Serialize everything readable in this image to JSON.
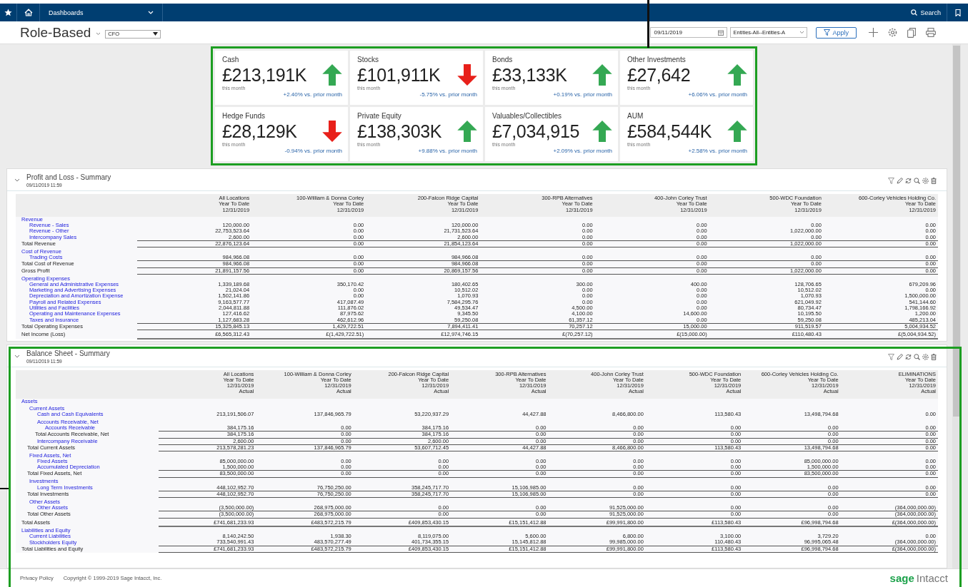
{
  "nav": {
    "menu": "Dashboards",
    "search": "Search"
  },
  "header": {
    "title": "Role-Based",
    "role": "CFO",
    "date": "09/11/2019",
    "entity": "Entities-All--Entities-A",
    "apply": "Apply"
  },
  "kpis": [
    {
      "label": "Cash",
      "value": "£213,191K",
      "rising": true,
      "period": "this month",
      "change": "+2.40% vs. prior month"
    },
    {
      "label": "Stocks",
      "value": "£101,911K",
      "rising": false,
      "period": "this month",
      "change": "-5.75% vs. prior month"
    },
    {
      "label": "Bonds",
      "value": "£33,133K",
      "rising": true,
      "period": "this month",
      "change": "+0.19% vs. prior month"
    },
    {
      "label": "Other Investments",
      "value": "£27,642",
      "rising": true,
      "period": "this month",
      "change": "+6.06% vs. prior month"
    },
    {
      "label": "Hedge Funds",
      "value": "£28,129K",
      "rising": false,
      "period": "this month",
      "change": "-0.94% vs. prior month"
    },
    {
      "label": "Private Equity",
      "value": "£138,303K",
      "rising": true,
      "period": "this month",
      "change": "+9.88% vs. prior month"
    },
    {
      "label": "Valuables/Collectibles",
      "value": "£7,034,915",
      "rising": true,
      "period": "this month",
      "change": "+2.09% vs. prior month"
    },
    {
      "label": "AUM",
      "value": "£584,544K",
      "rising": true,
      "period": "this month",
      "change": "+2.58% vs. prior month"
    }
  ],
  "reports": [
    {
      "kind": "pl",
      "title": "Profit and Loss - Summary",
      "timestamp": "09/11/2019 11:59",
      "columns": [
        [
          "All Locations",
          "Year To Date",
          "12/31/2019"
        ],
        [
          "100-William & Donna Corley",
          "Year To Date",
          "12/31/2019"
        ],
        [
          "200-Falcon Ridge Capital",
          "Year To Date",
          "12/31/2019"
        ],
        [
          "300-RPB Alternatives",
          "Year To Date",
          "12/31/2019"
        ],
        [
          "400-John Corley Trust",
          "Year To Date",
          "12/31/2019"
        ],
        [
          "500-WDC Foundation",
          "Year To Date",
          "12/31/2019"
        ],
        [
          "600-Corley Vehicles Holding Co.",
          "Year To Date",
          "12/31/2019"
        ]
      ],
      "rows": [
        {
          "kind": "group",
          "label": "Revenue",
          "children": [
            {
              "kind": "line",
              "label": "Revenue - Sales",
              "values": [
                "120,000.00",
                "0.00",
                "120,000.00",
                "0.00",
                "0.00",
                "0.00",
                "0.00"
              ]
            },
            {
              "kind": "line",
              "label": "Revenue - Other",
              "values": [
                "22,753,523.64",
                "0.00",
                "21,731,523.64",
                "0.00",
                "0.00",
                "1,022,000.00",
                "0.00"
              ]
            },
            {
              "kind": "line",
              "label": "Intercompany Sales",
              "values": [
                "2,600.00",
                "0.00",
                "2,600.00",
                "0.00",
                "0.00",
                "0.00",
                "0.00"
              ]
            }
          ]
        },
        {
          "kind": "total",
          "label": "Total Revenue",
          "values": [
            "22,876,123.64",
            "0.00",
            "21,854,123.64",
            "0.00",
            "0.00",
            "1,022,000.00",
            "0.00"
          ]
        },
        {
          "kind": "group",
          "label": "Cost of Revenue",
          "children": [
            {
              "kind": "line",
              "label": "Trading Costs",
              "values": [
                "984,966.08",
                "0.00",
                "984,966.08",
                "0.00",
                "0.00",
                "0.00",
                "0.00"
              ]
            }
          ]
        },
        {
          "kind": "total",
          "label": "Total Cost of Revenue",
          "values": [
            "984,966.08",
            "0.00",
            "984,966.08",
            "0.00",
            "0.00",
            "0.00",
            "0.00"
          ]
        },
        {
          "kind": "total",
          "label": "Gross Profit",
          "values": [
            "21,891,157.56",
            "0.00",
            "20,869,157.56",
            "0.00",
            "0.00",
            "1,022,000.00",
            "0.00"
          ]
        },
        {
          "kind": "group",
          "label": "Operating Expenses",
          "children": [
            {
              "kind": "line",
              "label": "General and Administrative Expenses",
              "values": [
                "1,339,189.68",
                "350,170.42",
                "180,402.65",
                "300.00",
                "400.00",
                "128,706.65",
                "679,209.96"
              ]
            },
            {
              "kind": "line",
              "label": "Marketing and Advertising Expenses",
              "values": [
                "21,024.04",
                "0.00",
                "10,512.02",
                "0.00",
                "0.00",
                "10,512.02",
                "0.00"
              ]
            },
            {
              "kind": "line",
              "label": "Depreciation and Amortization Expense",
              "values": [
                "1,502,141.86",
                "0.00",
                "1,070.93",
                "0.00",
                "0.00",
                "1,070.93",
                "1,500,000.00"
              ]
            },
            {
              "kind": "line",
              "label": "Payroll and Related Expenses",
              "values": [
                "9,163,577.77",
                "417,087.49",
                "7,584,295.76",
                "0.00",
                "0.00",
                "621,049.92",
                "541,144.60"
              ]
            },
            {
              "kind": "line",
              "label": "Utilities and Facilities",
              "values": [
                "2,044,811.88",
                "111,876.02",
                "49,534.47",
                "4,500.00",
                "0.00",
                "80,734.47",
                "1,798,166.92"
              ]
            },
            {
              "kind": "line",
              "label": "Operating and Maintenance Expenses",
              "values": [
                "127,416.62",
                "87,975.62",
                "9,345.50",
                "4,100.00",
                "14,600.00",
                "10,195.50",
                "1,200.00"
              ]
            },
            {
              "kind": "line",
              "label": "Taxes and Insurance",
              "values": [
                "1,127,683.28",
                "462,612.96",
                "59,250.08",
                "61,357.12",
                "0.00",
                "59,250.08",
                "485,213.04"
              ]
            }
          ]
        },
        {
          "kind": "total",
          "label": "Total Operating Expenses",
          "values": [
            "15,325,845.13",
            "1,429,722.51",
            "7,894,411.41",
            "70,257.12",
            "15,000.00",
            "911,519.57",
            "5,004,934.52"
          ]
        },
        {
          "kind": "grand",
          "label": "Net Income (Loss)",
          "values": [
            "£6,565,312.43",
            "£(1,429,722.51)",
            "£12,974,746.15",
            "£(70,257.12)",
            "£(15,000.00)",
            "£110,480.43",
            "£(5,004,934.52)"
          ]
        }
      ]
    },
    {
      "kind": "bs",
      "title": "Balance Sheet - Summary",
      "timestamp": "09/11/2019 11:59",
      "columns": [
        [
          "All Locations",
          "Year To Date",
          "12/31/2019",
          "Actual"
        ],
        [
          "100-William & Donna Corley",
          "Year To Date",
          "12/31/2019",
          "Actual"
        ],
        [
          "200-Falcon Ridge Capital",
          "Year To Date",
          "12/31/2019",
          "Actual"
        ],
        [
          "300-RPB Alternatives",
          "Year To Date",
          "12/31/2019",
          "Actual"
        ],
        [
          "400-John Corley Trust",
          "Year To Date",
          "12/31/2019",
          "Actual"
        ],
        [
          "500-WDC Foundation",
          "Year To Date",
          "12/31/2019",
          "Actual"
        ],
        [
          "600-Corley Vehicles Holding Co.",
          "Year To Date",
          "12/31/2019",
          "Actual"
        ],
        [
          "ELIMINATIONS",
          "Year To Date",
          "12/31/2019",
          "Actual"
        ]
      ],
      "rows": [
        {
          "kind": "group",
          "label": "Assets",
          "children": [
            {
              "kind": "group",
              "label": "Current Assets",
              "children": [
                {
                  "kind": "line",
                  "label": "Cash and Cash Equivalents",
                  "values": [
                    "213,191,506.07",
                    "137,846,965.79",
                    "53,220,937.29",
                    "44,427.88",
                    "8,466,800.00",
                    "113,580.43",
                    "13,498,794.68",
                    "0.00"
                  ]
                },
                {
                  "kind": "group",
                  "label": "Accounts Receivable, Net",
                  "children": [
                    {
                      "kind": "line",
                      "label": "Accounts Receivable",
                      "values": [
                        "384,175.16",
                        "0.00",
                        "384,175.16",
                        "0.00",
                        "0.00",
                        "0.00",
                        "0.00",
                        "0.00"
                      ]
                    }
                  ]
                },
                {
                  "kind": "total",
                  "label": "Total Accounts Receivable, Net",
                  "values": [
                    "384,175.16",
                    "0.00",
                    "384,175.16",
                    "0.00",
                    "0.00",
                    "0.00",
                    "0.00",
                    "0.00"
                  ]
                },
                {
                  "kind": "line",
                  "label": "Intercompany Receivable",
                  "values": [
                    "2,600.00",
                    "0.00",
                    "2,600.00",
                    "0.00",
                    "0.00",
                    "0.00",
                    "0.00",
                    "0.00"
                  ]
                }
              ]
            },
            {
              "kind": "total",
              "label": "Total Current Assets",
              "values": [
                "213,578,281.23",
                "137,846,965.79",
                "53,607,712.45",
                "44,427.88",
                "8,466,800.00",
                "113,580.43",
                "13,498,794.68",
                "0.00"
              ]
            },
            {
              "kind": "group",
              "label": "Fixed Assets, Net",
              "children": [
                {
                  "kind": "line",
                  "label": "Fixed Assets",
                  "values": [
                    "85,000,000.00",
                    "0.00",
                    "0.00",
                    "0.00",
                    "0.00",
                    "0.00",
                    "85,000,000.00",
                    "0.00"
                  ]
                },
                {
                  "kind": "line",
                  "label": "Accumulated Depreciation",
                  "values": [
                    "1,500,000.00",
                    "0.00",
                    "0.00",
                    "0.00",
                    "0.00",
                    "0.00",
                    "1,500,000.00",
                    "0.00"
                  ]
                }
              ]
            },
            {
              "kind": "total",
              "label": "Total Fixed Assets, Net",
              "values": [
                "83,500,000.00",
                "0.00",
                "0.00",
                "0.00",
                "0.00",
                "0.00",
                "83,500,000.00",
                "0.00"
              ]
            },
            {
              "kind": "group",
              "label": "Investments",
              "children": [
                {
                  "kind": "line",
                  "label": "Long Term Investments",
                  "values": [
                    "448,102,952.70",
                    "76,750,250.00",
                    "358,245,717.70",
                    "15,106,985.00",
                    "0.00",
                    "0.00",
                    "0.00",
                    "0.00"
                  ]
                }
              ]
            },
            {
              "kind": "total",
              "label": "Total Investments",
              "values": [
                "448,102,952.70",
                "76,750,250.00",
                "358,245,717.70",
                "15,106,985.00",
                "0.00",
                "0.00",
                "0.00",
                "0.00"
              ]
            },
            {
              "kind": "group",
              "label": "Other Assets",
              "children": [
                {
                  "kind": "line",
                  "label": "Other Assets",
                  "values": [
                    "(3,500,000.00)",
                    "268,975,000.00",
                    "0.00",
                    "0.00",
                    "91,525,000.00",
                    "0.00",
                    "0.00",
                    "(364,000,000.00)"
                  ]
                }
              ]
            },
            {
              "kind": "total",
              "label": "Total Other Assets",
              "values": [
                "(3,500,000.00)",
                "268,975,000.00",
                "0.00",
                "0.00",
                "91,525,000.00",
                "0.00",
                "0.00",
                "(364,000,000.00)"
              ]
            }
          ]
        },
        {
          "kind": "grand",
          "label": "Total Assets",
          "values": [
            "£741,681,233.93",
            "£483,572,215.79",
            "£409,853,430.15",
            "£15,151,412.88",
            "£99,991,800.00",
            "£113,580.43",
            "£96,998,794.68",
            "£(364,000,000.00)"
          ]
        },
        {
          "kind": "group",
          "label": "Liabilities and Equity",
          "children": [
            {
              "kind": "line",
              "label": "Current Liabilities",
              "values": [
                "8,140,242.50",
                "1,938.30",
                "8,119,075.00",
                "5,600.00",
                "6,800.00",
                "3,100.00",
                "3,729.20",
                "0.00"
              ]
            },
            {
              "kind": "line",
              "label": "Stockholders Equity",
              "values": [
                "733,540,991.43",
                "483,570,277.49",
                "401,734,355.15",
                "15,145,812.88",
                "99,985,000.00",
                "110,480.43",
                "96,995,065.48",
                "(364,000,000.00)"
              ]
            }
          ]
        },
        {
          "kind": "total",
          "label": "Total Liabilities and Equity",
          "values": [
            "£741,681,233.93",
            "£483,572,215.79",
            "£409,853,430.15",
            "£15,151,412.88",
            "£99,991,800.00",
            "£113,580.43",
            "£96,998,794.68",
            "£(364,000,000.00)"
          ]
        }
      ]
    }
  ],
  "footer": {
    "privacy": "Privacy Policy",
    "copyright": "Copyright © 1999-2019 Sage Intacct, Inc.",
    "brand": "sage",
    "product": "Intacct"
  }
}
